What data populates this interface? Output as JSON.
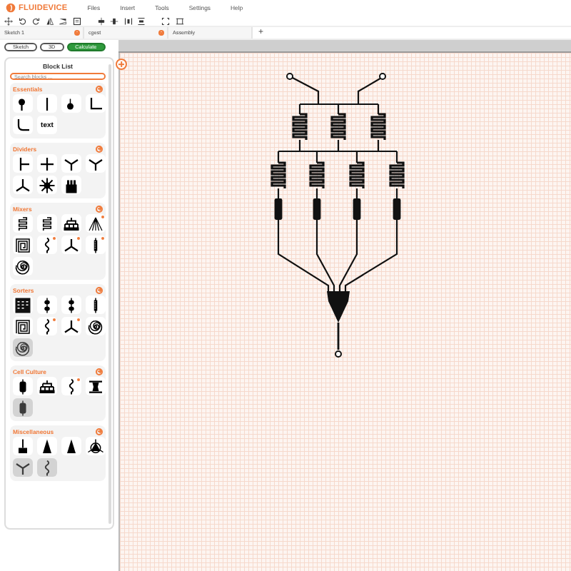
{
  "app": {
    "logo": "FLUIDEVICE",
    "menu": [
      "Files",
      "Insert",
      "Tools",
      "Settings",
      "Help"
    ]
  },
  "tabs": [
    {
      "label": "Sketch 1"
    },
    {
      "label": "cgest"
    },
    {
      "label": "Assembly"
    }
  ],
  "new_tab": "+",
  "mode_buttons": [
    {
      "label": "Sketch",
      "kind": "outline"
    },
    {
      "label": "3D",
      "kind": "outline"
    },
    {
      "label": "Calculate",
      "kind": "primary"
    }
  ],
  "block_list": {
    "title": "Block List",
    "search": {
      "placeholder": "Search blocks ..."
    },
    "sections": [
      {
        "title": "Essentials",
        "blocks": [
          {
            "kind": "port",
            "badge": false,
            "disabled": false
          },
          {
            "kind": "channel",
            "badge": false,
            "disabled": false
          },
          {
            "kind": "via",
            "badge": false,
            "disabled": false
          },
          {
            "kind": "corner",
            "badge": false,
            "disabled": false
          },
          {
            "kind": "curve",
            "badge": false,
            "disabled": false
          },
          {
            "kind": "text",
            "label": "text",
            "badge": false,
            "disabled": false
          }
        ]
      },
      {
        "title": "Dividers",
        "blocks": [
          {
            "kind": "tee",
            "badge": false,
            "disabled": false
          },
          {
            "kind": "cross",
            "badge": false,
            "disabled": false
          },
          {
            "kind": "ysplit",
            "badge": false,
            "disabled": false
          },
          {
            "kind": "ysplit",
            "badge": false,
            "disabled": false
          },
          {
            "kind": "ymerge",
            "badge": false,
            "disabled": false
          },
          {
            "kind": "star",
            "badge": false,
            "disabled": false
          },
          {
            "kind": "comb",
            "badge": false,
            "disabled": false
          }
        ]
      },
      {
        "title": "Mixers",
        "blocks": [
          {
            "kind": "serpentine",
            "badge": false,
            "disabled": false
          },
          {
            "kind": "serpentine",
            "badge": false,
            "disabled": false
          },
          {
            "kind": "tree",
            "badge": false,
            "disabled": false
          },
          {
            "kind": "gradient",
            "badge": true,
            "disabled": false
          },
          {
            "kind": "square_spiral",
            "badge": false,
            "disabled": false
          },
          {
            "kind": "wavy",
            "badge": true,
            "disabled": false
          },
          {
            "kind": "ymerge",
            "badge": true,
            "disabled": false
          },
          {
            "kind": "chain",
            "badge": true,
            "disabled": false
          },
          {
            "kind": "spiral",
            "badge": false,
            "disabled": false
          }
        ]
      },
      {
        "title": "Sorters",
        "blocks": [
          {
            "kind": "grid_chip",
            "badge": false,
            "disabled": false
          },
          {
            "kind": "chamber",
            "badge": false,
            "disabled": false
          },
          {
            "kind": "chamber",
            "badge": false,
            "disabled": false
          },
          {
            "kind": "chain",
            "badge": false,
            "disabled": false
          },
          {
            "kind": "square_spiral",
            "badge": false,
            "disabled": false
          },
          {
            "kind": "wavy",
            "badge": true,
            "disabled": false
          },
          {
            "kind": "ymerge",
            "badge": true,
            "disabled": false
          },
          {
            "kind": "spiral",
            "badge": false,
            "disabled": false
          },
          {
            "kind": "spiral",
            "badge": false,
            "disabled": true
          }
        ]
      },
      {
        "title": "Cell Culture",
        "blocks": [
          {
            "kind": "capsule",
            "badge": false,
            "disabled": false
          },
          {
            "kind": "tree",
            "badge": false,
            "disabled": false
          },
          {
            "kind": "wavy",
            "badge": true,
            "disabled": false
          },
          {
            "kind": "trap",
            "badge": false,
            "disabled": false
          },
          {
            "kind": "capsule",
            "badge": false,
            "disabled": true
          }
        ]
      },
      {
        "title": "Miscellaneous",
        "blocks": [
          {
            "kind": "valve",
            "badge": false,
            "disabled": false
          },
          {
            "kind": "cone",
            "badge": false,
            "disabled": false
          },
          {
            "kind": "cone",
            "badge": false,
            "disabled": false
          },
          {
            "kind": "triangle_valve",
            "badge": false,
            "disabled": false
          },
          {
            "kind": "ysplit",
            "badge": false,
            "disabled": true
          },
          {
            "kind": "wavy",
            "badge": false,
            "disabled": true
          }
        ]
      }
    ]
  }
}
